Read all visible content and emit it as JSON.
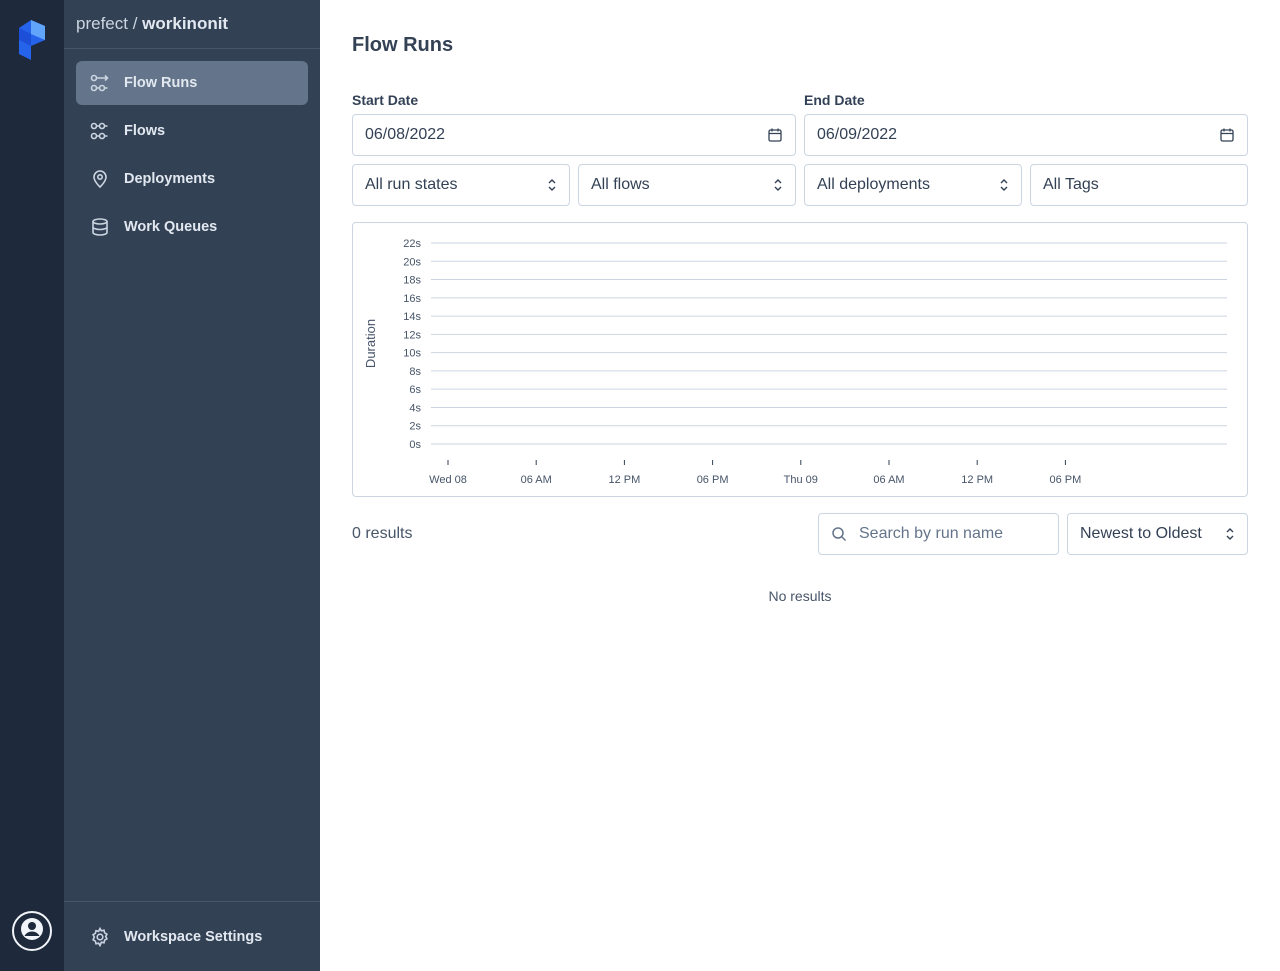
{
  "sidebar": {
    "breadcrumb": {
      "org": "prefect",
      "separator": " / ",
      "workspace": "workinonit"
    },
    "items": [
      {
        "label": "Flow Runs",
        "icon": "flow-runs-icon",
        "active": true
      },
      {
        "label": "Flows",
        "icon": "flows-icon",
        "active": false
      },
      {
        "label": "Deployments",
        "icon": "map-pin-icon",
        "active": false
      },
      {
        "label": "Work Queues",
        "icon": "database-icon",
        "active": false
      }
    ],
    "footer": {
      "label": "Workspace Settings",
      "icon": "gear-icon"
    }
  },
  "main": {
    "title": "Flow Runs",
    "start_date": {
      "label": "Start Date",
      "value": "06/08/2022"
    },
    "end_date": {
      "label": "End Date",
      "value": "06/09/2022"
    },
    "filters": {
      "states": "All run states",
      "flows": "All flows",
      "deployments": "All deployments",
      "tags": "All Tags"
    },
    "results_count": "0 results",
    "search_placeholder": "Search by run name",
    "sort": "Newest to Oldest",
    "empty_message": "No results"
  },
  "colors": {
    "rail": "#1e293b",
    "sidebar": "#334155",
    "active_item": "#64748b",
    "border": "#cbd5e1"
  },
  "chart_data": {
    "type": "scatter",
    "ylabel": "Duration",
    "y_ticks": [
      "0s",
      "2s",
      "4s",
      "6s",
      "8s",
      "10s",
      "12s",
      "14s",
      "16s",
      "18s",
      "20s",
      "22s"
    ],
    "x_ticks": [
      "Wed 08",
      "06 AM",
      "12 PM",
      "06 PM",
      "Thu 09",
      "06 AM",
      "12 PM",
      "06 PM"
    ],
    "ylim": [
      0,
      22
    ],
    "series": [],
    "grid": true
  }
}
